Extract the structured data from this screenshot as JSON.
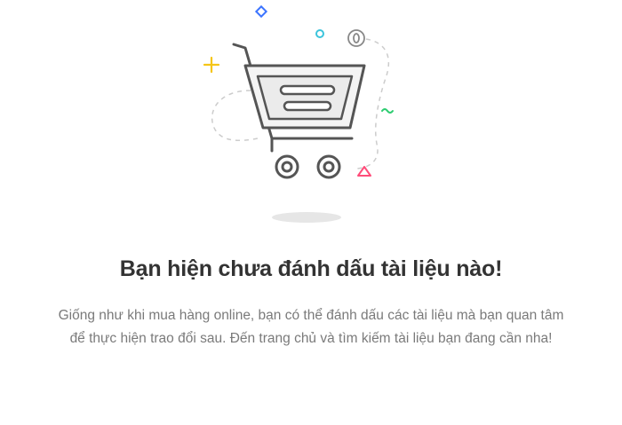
{
  "empty_state": {
    "title": "Bạn hiện chưa đánh dấu tài liệu nào!",
    "description_line1": "Giống như khi mua hàng online, bạn có thể đánh dấu các tài liệu mà bạn quan tâm",
    "description_line2": "để thực hiện trao đổi sau. Đến trang chủ và tìm kiếm tài liệu bạn đang cần nha!",
    "illustration": {
      "icon": "shopping-cart-icon",
      "decorations": [
        "diamond-icon",
        "circle-icon",
        "coin-icon",
        "sparkle-icon",
        "squiggle-icon",
        "triangle-icon"
      ],
      "colors": {
        "stroke": "#555555",
        "fill": "#ebebeb",
        "accent_yellow": "#f5c518",
        "accent_cyan": "#3cc4dc",
        "accent_blue": "#3c74ff",
        "accent_green": "#2ecc71",
        "accent_pink": "#ff4d7a",
        "shadow": "#e6e6e6"
      }
    }
  }
}
